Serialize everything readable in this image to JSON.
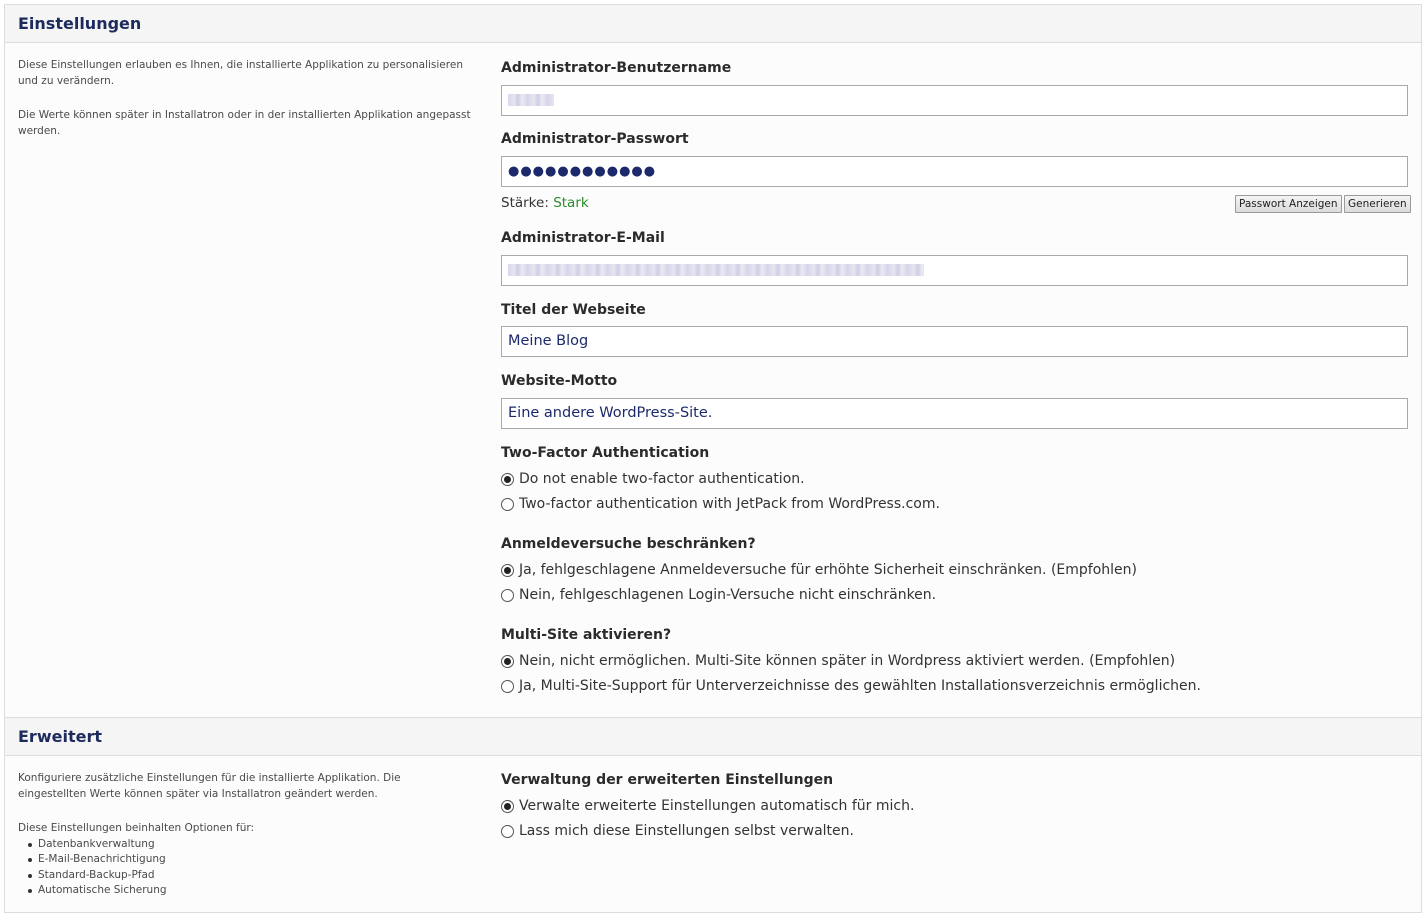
{
  "einstellungen": {
    "title": "Einstellungen",
    "desc": [
      "Diese Einstellungen erlauben es Ihnen, die installierte Applikation zu personalisieren und zu verändern.",
      "Die Werte können später in Installatron oder in der installierten Applikation angepasst werden."
    ],
    "admin_user": {
      "label": "Administrator-Benutzername"
    },
    "admin_password": {
      "label": "Administrator-Passwort",
      "masked": "●●●●●●●●●●●●",
      "strength_label": "Stärke:",
      "strength_value": "Stark",
      "strength_color": "#2b8a2b",
      "show_button": "Passwort Anzeigen",
      "generate_button": "Generieren"
    },
    "admin_email": {
      "label": "Administrator-E-Mail"
    },
    "site_title": {
      "label": "Titel der Webseite",
      "value": "Meine Blog"
    },
    "site_motto": {
      "label": "Website-Motto",
      "value": "Eine andere WordPress-Site."
    },
    "two_factor": {
      "label": "Two-Factor Authentication",
      "options": [
        {
          "label": "Do not enable two-factor authentication.",
          "checked": true
        },
        {
          "label": "Two-factor authentication with JetPack from WordPress.com.",
          "checked": false
        }
      ]
    },
    "login_limit": {
      "label": "Anmeldeversuche beschränken?",
      "options": [
        {
          "label": "Ja, fehlgeschlagene Anmeldeversuche für erhöhte Sicherheit einschränken. (Empfohlen)",
          "checked": true
        },
        {
          "label": "Nein, fehlgeschlagenen Login-Versuche nicht einschränken.",
          "checked": false
        }
      ]
    },
    "multisite": {
      "label": "Multi-Site aktivieren?",
      "options": [
        {
          "label": "Nein, nicht ermöglichen. Multi-Site können später in Wordpress aktiviert werden. (Empfohlen)",
          "checked": true
        },
        {
          "label": "Ja, Multi-Site-Support für Unterverzeichnisse des gewählten Installationsverzeichnis ermöglichen.",
          "checked": false
        }
      ]
    }
  },
  "erweitert": {
    "title": "Erweitert",
    "desc": [
      "Konfiguriere zusätzliche Einstellungen für die installierte Applikation. Die eingestellten Werte können später via Installatron geändert werden.",
      "Diese Einstellungen beinhalten Optionen für:"
    ],
    "list": [
      "Datenbankverwaltung",
      "E-Mail-Benachrichtigung",
      "Standard-Backup-Pfad",
      "Automatische Sicherung"
    ],
    "management": {
      "label": "Verwaltung der erweiterten Einstellungen",
      "options": [
        {
          "label": "Verwalte erweiterte Einstellungen automatisch für mich.",
          "checked": true
        },
        {
          "label": "Lass mich diese Einstellungen selbst verwalten.",
          "checked": false
        }
      ]
    }
  }
}
